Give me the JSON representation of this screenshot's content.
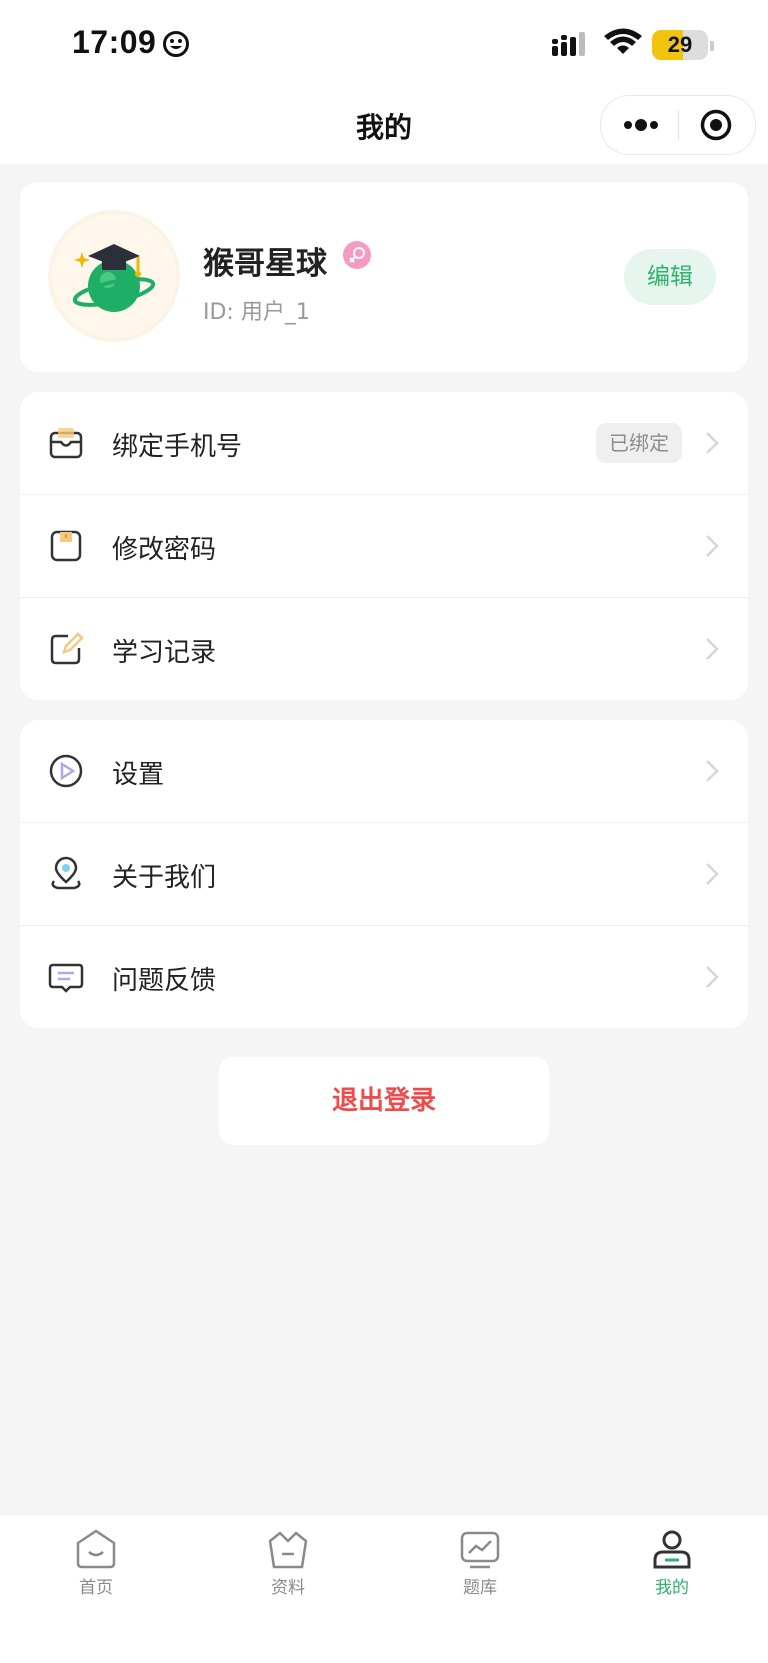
{
  "status_bar": {
    "time": "17:09",
    "battery": "29",
    "battery_level": 0.29
  },
  "nav": {
    "title": "我的"
  },
  "profile": {
    "username": "猴哥星球",
    "user_id": "ID: 用户_1",
    "edit_label": "编辑"
  },
  "menu_group_1": [
    {
      "label": "绑定手机号",
      "badge": "已绑定",
      "icon": "phone-bind-icon"
    },
    {
      "label": "修改密码",
      "icon": "password-icon"
    },
    {
      "label": "学习记录",
      "icon": "study-record-icon"
    }
  ],
  "menu_group_2": [
    {
      "label": "设置",
      "icon": "settings-play-icon"
    },
    {
      "label": "关于我们",
      "icon": "location-icon"
    },
    {
      "label": "问题反馈",
      "icon": "feedback-icon"
    }
  ],
  "logout_label": "退出登录",
  "tabbar": {
    "items": [
      {
        "label": "首页",
        "icon": "home-icon"
      },
      {
        "label": "资料",
        "icon": "materials-icon"
      },
      {
        "label": "题库",
        "icon": "question-bank-icon"
      },
      {
        "label": "我的",
        "icon": "profile-icon"
      }
    ],
    "active_index": 3
  },
  "colors": {
    "accent": "#2db36b",
    "danger": "#ef4b4b",
    "background": "#f5f5f5",
    "badge_bg": "#e6f6ee",
    "gender_pink": "#f59ac0"
  }
}
